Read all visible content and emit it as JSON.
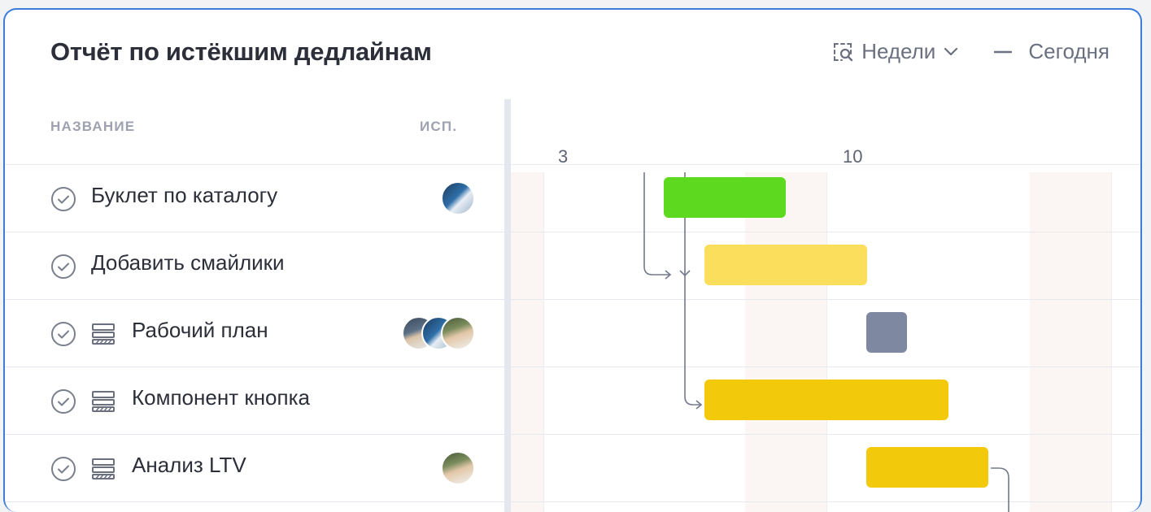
{
  "header": {
    "title": "Отчёт по истёкшим дедлайнам",
    "scale_label": "Недели",
    "today_label": "Сегодня"
  },
  "columns": {
    "name": "НАЗВАНИЕ",
    "assignee": "ИСП."
  },
  "timeline": {
    "day_labels": [
      "3",
      "10"
    ]
  },
  "rows": [
    {
      "label": "Буклет по каталогу",
      "has_subtasks": false,
      "avatars": 1,
      "bar_color": "#5dd91f",
      "status": "green"
    },
    {
      "label": "Добавить смайлики",
      "has_subtasks": false,
      "avatars": 0,
      "bar_color": "#fade5c",
      "status": "yellow"
    },
    {
      "label": "Рабочий план",
      "has_subtasks": true,
      "avatars": 3,
      "bar_color": "#7f88a1",
      "status": "gray"
    },
    {
      "label": "Компонент кнопка",
      "has_subtasks": true,
      "avatars": 0,
      "bar_color": "#f2ca0b",
      "status": "yellow"
    },
    {
      "label": "Анализ LTV",
      "has_subtasks": true,
      "avatars": 1,
      "bar_color": "#f2ca0b",
      "status": "yellow"
    }
  ],
  "colors": {
    "accent": "#3b7ddd",
    "text": "#2c2f3a",
    "muted": "#9ea2b0"
  }
}
